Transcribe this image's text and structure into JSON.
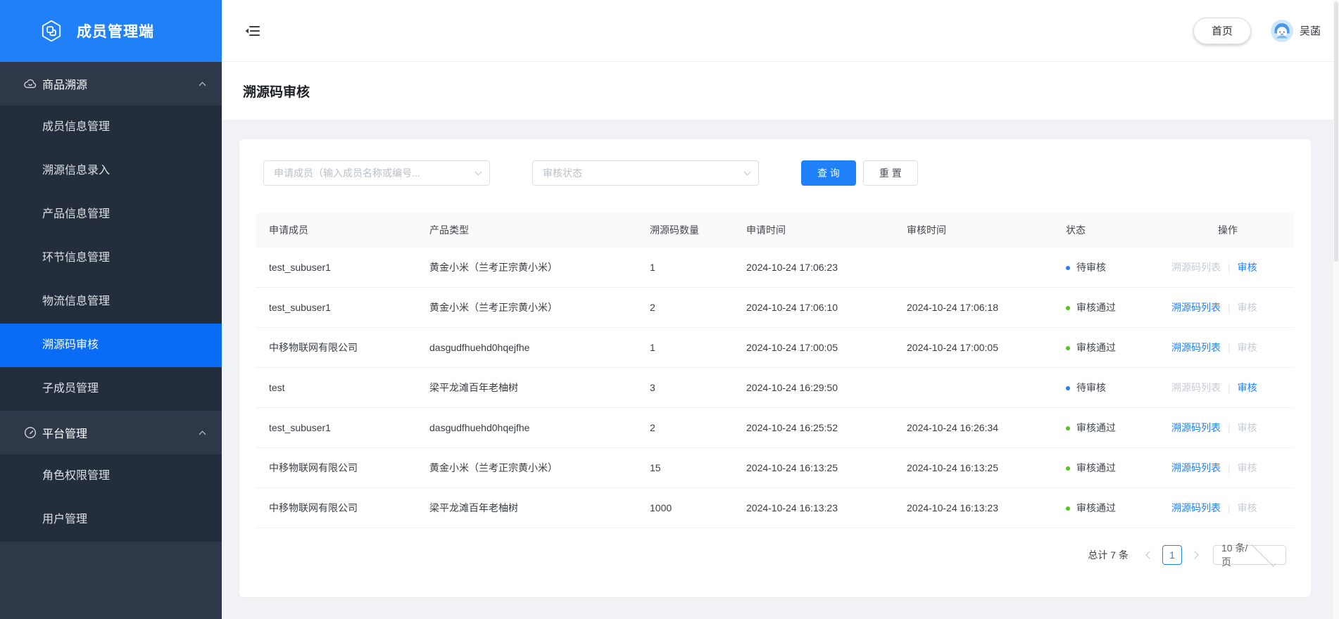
{
  "colors": {
    "brand": "#2080f7",
    "menu-active": "#0a6bf4",
    "accent": "#2080f7",
    "approved-green": "#52c41a",
    "sidebar-bg": "#2e3848",
    "submenu-bg": "#242d3b",
    "content-bg": "#f0f2f5",
    "disabled-link": "#c6cbd4"
  },
  "sidebar": {
    "title": "成员管理端",
    "groups": [
      {
        "id": "product-trace",
        "label": "商品溯源",
        "icon": "cloud-icon",
        "expanded": true,
        "items": [
          {
            "label": "成员信息管理",
            "active": false
          },
          {
            "label": "溯源信息录入",
            "active": false
          },
          {
            "label": "产品信息管理",
            "active": false
          },
          {
            "label": "环节信息管理",
            "active": false
          },
          {
            "label": "物流信息管理",
            "active": false
          },
          {
            "label": "溯源码审核",
            "active": true
          },
          {
            "label": "子成员管理",
            "active": false
          }
        ]
      },
      {
        "id": "platform",
        "label": "平台管理",
        "icon": "gauge-icon",
        "expanded": true,
        "items": [
          {
            "label": "角色权限管理",
            "active": false
          },
          {
            "label": "用户管理",
            "active": false
          }
        ]
      }
    ]
  },
  "topbar": {
    "home_label": "首页",
    "username": "吴菡"
  },
  "page": {
    "title": "溯源码审核"
  },
  "filters": {
    "member_placeholder": "申请成员（输入成员名称或编号...",
    "status_placeholder": "审核状态",
    "search_label": "查 询",
    "reset_label": "重 置"
  },
  "table": {
    "columns": [
      {
        "key": "member",
        "label": "申请成员"
      },
      {
        "key": "product",
        "label": "产品类型"
      },
      {
        "key": "qty",
        "label": "溯源码数量"
      },
      {
        "key": "apply_time",
        "label": "申请时间"
      },
      {
        "key": "review_time",
        "label": "审核时间"
      },
      {
        "key": "status",
        "label": "状态"
      },
      {
        "key": "actions",
        "label": "操作"
      }
    ],
    "action_labels": {
      "list": "溯源码列表",
      "review": "审核",
      "separator": "|"
    },
    "rows": [
      {
        "member": "test_subuser1",
        "product": "黄金小米（兰考正宗黄小米）",
        "qty": "1",
        "apply_time": "2024-10-24 17:06:23",
        "review_time": "",
        "status": "pending",
        "status_label": "待审核",
        "list_enabled": false,
        "review_enabled": true
      },
      {
        "member": "test_subuser1",
        "product": "黄金小米（兰考正宗黄小米）",
        "qty": "2",
        "apply_time": "2024-10-24 17:06:10",
        "review_time": "2024-10-24 17:06:18",
        "status": "approved",
        "status_label": "审核通过",
        "list_enabled": true,
        "review_enabled": false
      },
      {
        "member": "中移物联网有限公司",
        "product": "dasgudfhuehd0hqejfhe",
        "qty": "1",
        "apply_time": "2024-10-24 17:00:05",
        "review_time": "2024-10-24 17:00:05",
        "status": "approved",
        "status_label": "审核通过",
        "list_enabled": true,
        "review_enabled": false
      },
      {
        "member": "test",
        "product": "梁平龙滩百年老柚树",
        "qty": "3",
        "apply_time": "2024-10-24 16:29:50",
        "review_time": "",
        "status": "pending",
        "status_label": "待审核",
        "list_enabled": false,
        "review_enabled": true
      },
      {
        "member": "test_subuser1",
        "product": "dasgudfhuehd0hqejfhe",
        "qty": "2",
        "apply_time": "2024-10-24 16:25:52",
        "review_time": "2024-10-24 16:26:34",
        "status": "approved",
        "status_label": "审核通过",
        "list_enabled": true,
        "review_enabled": false
      },
      {
        "member": "中移物联网有限公司",
        "product": "黄金小米（兰考正宗黄小米）",
        "qty": "15",
        "apply_time": "2024-10-24 16:13:25",
        "review_time": "2024-10-24 16:13:25",
        "status": "approved",
        "status_label": "审核通过",
        "list_enabled": true,
        "review_enabled": false
      },
      {
        "member": "中移物联网有限公司",
        "product": "梁平龙滩百年老柚树",
        "qty": "1000",
        "apply_time": "2024-10-24 16:13:23",
        "review_time": "2024-10-24 16:13:23",
        "status": "approved",
        "status_label": "审核通过",
        "list_enabled": true,
        "review_enabled": false
      }
    ]
  },
  "pagination": {
    "total_label": "总计 7 条",
    "current_page": "1",
    "page_size_label": "10 条/页"
  }
}
